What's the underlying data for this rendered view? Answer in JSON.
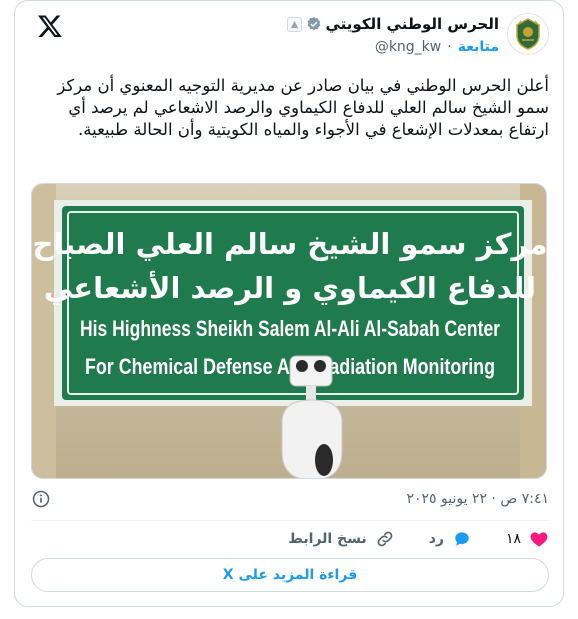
{
  "account": {
    "display_name": "الحرس الوطني الكويتي",
    "handle": "@kng_kw",
    "separator": "·",
    "follow_label": "متابعة",
    "verified_color": "#829aab"
  },
  "tweet": {
    "text": "أعلن الحرس الوطني في بيان صادر عن مديرية التوجيه المعنوي أن مركز سمو الشيخ سالم العلي للدفاع الكيماوي والرصد الاشعاعي لم يرصد أي ارتفاع بمعدلات الإشعاع في الأجواء والمياه الكويتية وأن الحالة طبيعية.",
    "timestamp": "٧:٤١ ص · ٢٢ يونيو ٢٠٢٥"
  },
  "media": {
    "sign_line1": "مركز سمو الشيخ سالم العلي الصباح",
    "sign_line2": "للدفاع الكيماوي و الرصد الأشعاعي",
    "sign_line3": "His Highness Sheikh Salem Al-Ali Al-Sabah Center",
    "sign_line4": "For Chemical Defense And Radiation Monitoring",
    "sign_color": "#1f7a4d"
  },
  "actions": {
    "likes": "١٨",
    "reply_label": "رد",
    "copy_link_label": "نسخ الرابط",
    "like_color": "#f91880",
    "reply_color": "#1d9bf0"
  },
  "read_more_label": "قراءة المزيد على X"
}
